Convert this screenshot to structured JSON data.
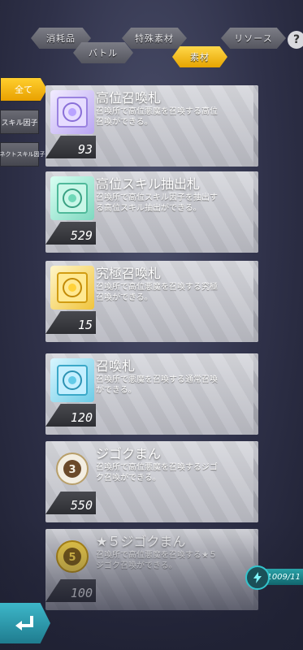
{
  "top_tabs": [
    {
      "label": "消耗品"
    },
    {
      "label": "バトル"
    },
    {
      "label": "特殊素材"
    },
    {
      "label": "素材"
    },
    {
      "label": "リソース"
    }
  ],
  "help_label": "?",
  "side_tabs": [
    {
      "label": "全て"
    },
    {
      "label": "スキル因子"
    },
    {
      "label": "コネクトスキル因子"
    }
  ],
  "items": [
    {
      "name": "高位召喚札",
      "desc": "召喚所で高位悪魔を召喚する高位召喚ができる。",
      "count": "93",
      "icon": "summon-card-purple-icon",
      "color": "#c9b6ff"
    },
    {
      "name": "高位スキル抽出札",
      "desc": "召喚所で高位スキル因子を抽出する高位スキル抽出ができる。",
      "count": "529",
      "icon": "skill-extract-card-green-icon",
      "color": "#7fe3c7"
    },
    {
      "name": "究極召喚札",
      "desc": "召喚所で高位悪魔を召喚する究極召喚ができる。",
      "count": "15",
      "icon": "summon-card-gold-icon",
      "color": "#ffd95a"
    },
    {
      "name": "召喚札",
      "desc": "召喚所で悪魔を召喚する通常召喚ができる。",
      "count": "120",
      "icon": "summon-card-blue-icon",
      "color": "#7fd8ef"
    },
    {
      "name": "ジゴクまん",
      "desc": "召喚所で高位悪魔を召喚するジゴク召喚ができる。",
      "count": "550",
      "icon": "jigoku-bun-icon",
      "color": "#f2ede2"
    },
    {
      "name": "★５ジゴクまん",
      "desc": "召喚所で高位悪魔を召喚する★５ジゴク召喚ができる。",
      "count": "100",
      "icon": "jigoku-bun-gold-icon",
      "color": "#f5d24a"
    }
  ],
  "capacity": "1009/11"
}
